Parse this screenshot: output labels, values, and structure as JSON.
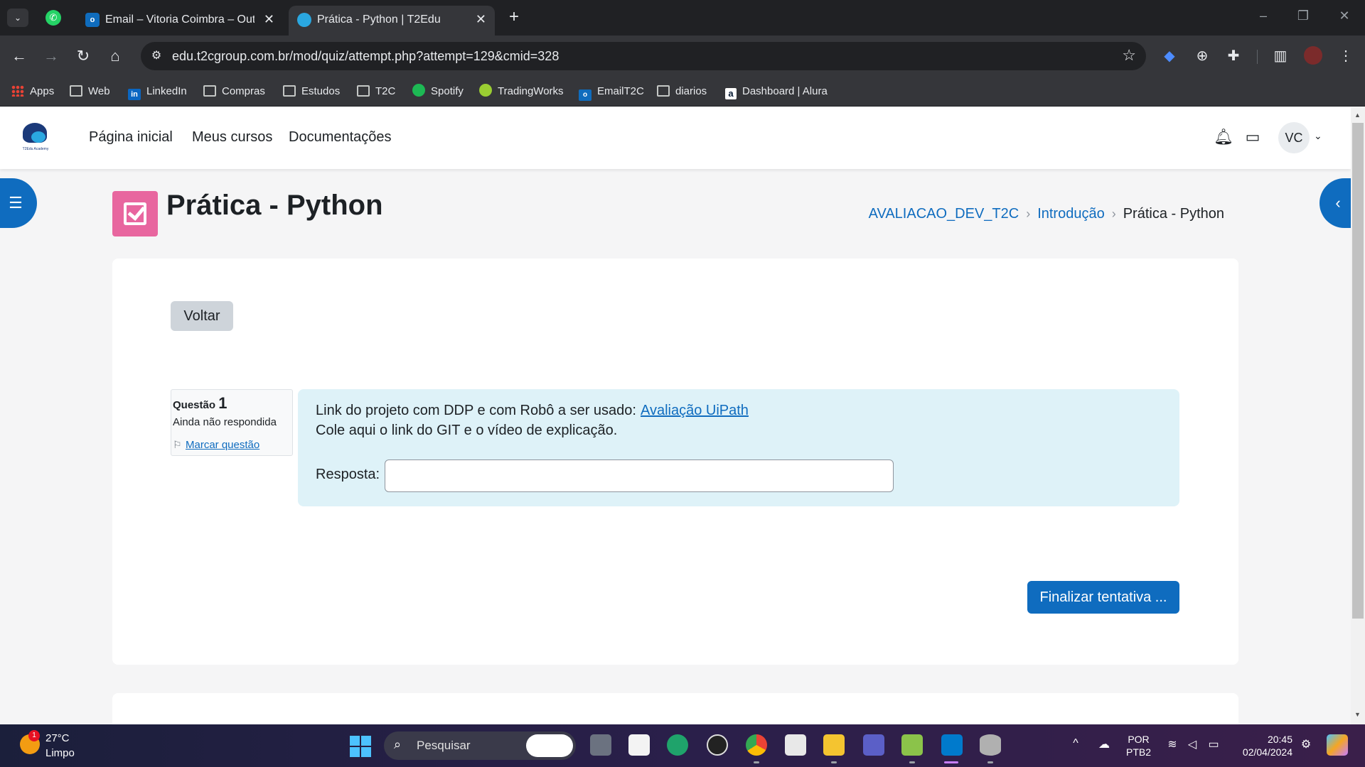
{
  "browser": {
    "tabs": [
      {
        "title": "Email – Vitoria Coimbra – Outlo",
        "active": false
      },
      {
        "title": "Prática - Python | T2Edu",
        "active": true
      }
    ],
    "url": "edu.t2cgroup.com.br/mod/quiz/attempt.php?attempt=129&cmid=328",
    "bookmarks": [
      {
        "label": "Apps",
        "icon": "apps-icon"
      },
      {
        "label": "Web",
        "icon": "folder-icon"
      },
      {
        "label": "LinkedIn",
        "icon": "linkedin-icon"
      },
      {
        "label": "Compras",
        "icon": "folder-icon"
      },
      {
        "label": "Estudos",
        "icon": "folder-icon"
      },
      {
        "label": "T2C",
        "icon": "folder-icon"
      },
      {
        "label": "Spotify",
        "icon": "spotify-icon"
      },
      {
        "label": "TradingWorks",
        "icon": "tradingworks-icon"
      },
      {
        "label": "EmailT2C",
        "icon": "outlook-icon"
      },
      {
        "label": "diarios",
        "icon": "folder-icon"
      },
      {
        "label": "Dashboard | Alura",
        "icon": "alura-icon"
      }
    ]
  },
  "site": {
    "logo_text": "T2Edu Academy",
    "nav": [
      "Página inicial",
      "Meus cursos",
      "Documentações"
    ],
    "user_initials": "VC"
  },
  "page": {
    "title": "Prática - Python",
    "breadcrumb": [
      {
        "label": "AVALIACAO_DEV_T2C",
        "link": true
      },
      {
        "label": "Introdução",
        "link": true
      },
      {
        "label": "Prática - Python",
        "link": false
      }
    ],
    "back_label": "Voltar",
    "finish_label": "Finalizar tentativa ..."
  },
  "question": {
    "label": "Questão",
    "number": "1",
    "state": "Ainda não respondida",
    "flag_label": "Marcar questão",
    "line1": "Link do projeto com DDP e com Robô a ser usado:",
    "link_text": "Avaliação UiPath",
    "line2": "Cole aqui o link do GIT e o vídeo de explicação.",
    "answer_label": "Resposta:",
    "answer_value": ""
  },
  "taskbar": {
    "weather_badge": "1",
    "temperature": "27°C",
    "weather": "Limpo",
    "search_placeholder": "Pesquisar",
    "lang_line1": "POR",
    "lang_line2": "PTB2",
    "time": "20:45",
    "date": "02/04/2024"
  },
  "colors": {
    "accent": "#0f6cbf",
    "quiz_icon": "#e8669f",
    "question_bg": "#def2f8"
  }
}
